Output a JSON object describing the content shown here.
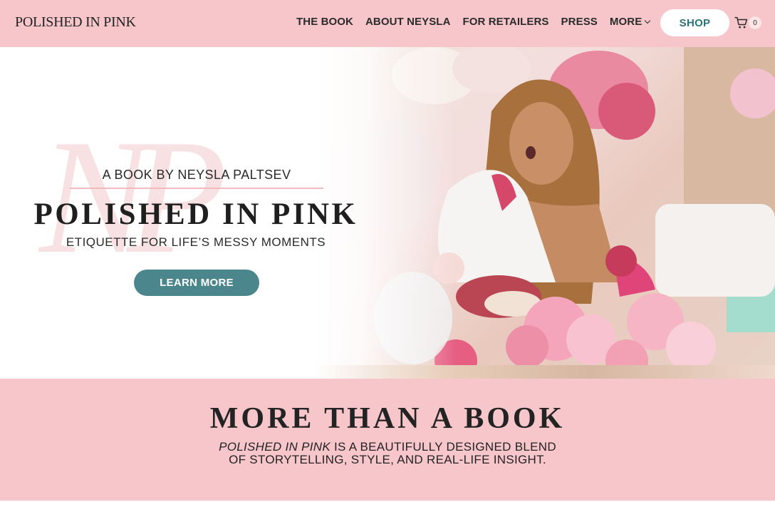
{
  "header": {
    "logo": "POLISHED IN PINK",
    "nav": [
      {
        "label": "THE BOOK"
      },
      {
        "label": "ABOUT NEYSLA"
      },
      {
        "label": "FOR RETAILERS"
      },
      {
        "label": "PRESS"
      },
      {
        "label": "MORE"
      }
    ],
    "shop_label": "SHOP",
    "cart_count": "0"
  },
  "hero": {
    "kicker": "A BOOK BY NEYSLA PALTSEV",
    "title": "POLISHED IN PINK",
    "subtitle": "ETIQUETTE FOR LIFE’S MESSY MOMENTS",
    "cta": "LEARN MORE",
    "monogram": "NP"
  },
  "section": {
    "title": "MORE THAN A BOOK",
    "line1_em": "POLISHED IN PINK",
    "line1_rest": " IS A BEAUTIFULLY DESIGNED BLEND",
    "line2": "OF STORYTELLING, STYLE, AND REAL-LIFE INSIGHT."
  },
  "colors": {
    "brand_pink": "#f6c6cb",
    "accent_teal": "#4a868c",
    "shop_text": "#2f7079"
  },
  "icons": [
    "cart-icon",
    "chevron-down-icon"
  ]
}
